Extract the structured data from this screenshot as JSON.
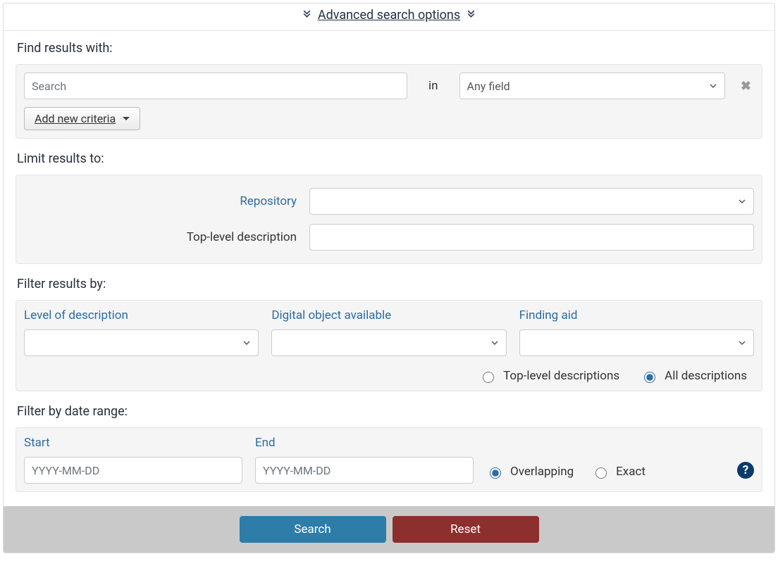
{
  "header": {
    "title": "Advanced search options"
  },
  "sections": {
    "find_results": "Find results with:",
    "limit_results": "Limit results to:",
    "filter_results": "Filter results by:",
    "filter_date": "Filter by date range:"
  },
  "criteria": {
    "search_placeholder": "Search",
    "in_label": "in",
    "field_select_value": "Any field",
    "add_new_label": "Add new criteria"
  },
  "limits": {
    "repository_label": "Repository",
    "top_level_label": "Top-level description"
  },
  "filters": {
    "level_label": "Level of description",
    "digital_label": "Digital object available",
    "finding_aid_label": "Finding aid",
    "radio_top_level": "Top-level descriptions",
    "radio_all": "All descriptions"
  },
  "dates": {
    "start_label": "Start",
    "end_label": "End",
    "placeholder": "YYYY-MM-DD",
    "overlapping": "Overlapping",
    "exact": "Exact"
  },
  "footer": {
    "search": "Search",
    "reset": "Reset"
  }
}
